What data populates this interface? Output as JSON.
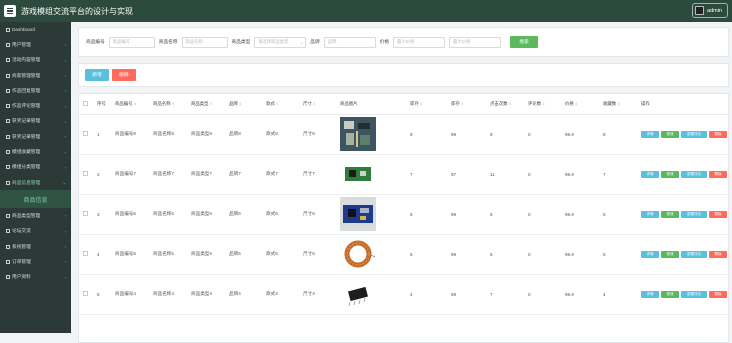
{
  "app": {
    "title": "游戏模组交流平台的设计与实现",
    "user": "admin"
  },
  "sidebar": {
    "items": [
      {
        "label": "Dashboard",
        "icon": "home-icon"
      },
      {
        "label": "用户管理",
        "icon": "user-icon"
      },
      {
        "label": "活动内容管理",
        "icon": "list-icon"
      },
      {
        "label": "商家管理管理",
        "icon": "store-icon"
      },
      {
        "label": "作品回复管理",
        "icon": "grid-icon"
      },
      {
        "label": "作品评论管理",
        "icon": "comment-icon"
      },
      {
        "label": "获奖记录管理",
        "icon": "grid-icon"
      },
      {
        "label": "获奖记录管理",
        "icon": "grid-icon"
      },
      {
        "label": "模组收藏管理",
        "icon": "grid-icon"
      },
      {
        "label": "模组分类管理",
        "icon": "grid-icon"
      },
      {
        "label": "商品信息管理",
        "icon": "grid-icon"
      }
    ],
    "active_sub": "商品信息",
    "items_after": [
      {
        "label": "商品类型管理",
        "icon": "grid-icon"
      },
      {
        "label": "论坛交流",
        "icon": "grid-icon"
      },
      {
        "label": "系统管理",
        "icon": "grid-icon"
      },
      {
        "label": "订单管理",
        "icon": "grid-icon"
      },
      {
        "label": "用户资料",
        "icon": "user-icon"
      }
    ]
  },
  "filters": {
    "code_label": "商品编号",
    "code_placeholder": "商品编号",
    "name_label": "商品名称",
    "name_placeholder": "商品名称",
    "type_label": "商品类型",
    "type_placeholder": "请选择商品类型",
    "brand_label": "品牌",
    "brand_placeholder": "品牌",
    "price_label": "价格",
    "price_min_placeholder": "最小价格",
    "price_max_placeholder": "最大价格",
    "search_button": "搜索"
  },
  "actions": {
    "add": "新增",
    "delete": "删除"
  },
  "table": {
    "headers": [
      "序号",
      "商品编号",
      "商品名称",
      "商品类型",
      "品牌",
      "款式",
      "尺寸",
      "商品图片",
      "库存",
      "库存",
      "点击次数",
      "评论数",
      "价格",
      "收藏数",
      "操作"
    ],
    "rows": [
      {
        "index": "1",
        "code": "商品编号8",
        "name": "商品名称8",
        "type": "商品类型8",
        "brand": "品牌8",
        "style": "款式8",
        "size": "尺寸8",
        "image": "circuit-board",
        "stock": "8",
        "stock2": "99",
        "clicks": "8",
        "comments": "0",
        "price": "99.9",
        "favorites": "8"
      },
      {
        "index": "2",
        "code": "商品编号7",
        "name": "商品名称7",
        "type": "商品类型7",
        "brand": "品牌7",
        "style": "款式7",
        "size": "尺寸7",
        "image": "green-module",
        "stock": "7",
        "stock2": "97",
        "clicks": "11",
        "comments": "0",
        "price": "99.9",
        "favorites": "7"
      },
      {
        "index": "3",
        "code": "商品编号6",
        "name": "商品名称6",
        "type": "商品类型6",
        "brand": "品牌6",
        "style": "款式6",
        "size": "尺寸6",
        "image": "blue-board",
        "stock": "6",
        "stock2": "99",
        "clicks": "6",
        "comments": "0",
        "price": "99.9",
        "favorites": "6"
      },
      {
        "index": "4",
        "code": "商品编号5",
        "name": "商品名称5",
        "type": "商品类型5",
        "brand": "品牌5",
        "style": "款式5",
        "size": "尺寸5",
        "image": "ferrite-coil",
        "stock": "5",
        "stock2": "99",
        "clicks": "5",
        "comments": "0",
        "price": "99.9",
        "favorites": "5"
      },
      {
        "index": "5",
        "code": "商品编号4",
        "name": "商品名称4",
        "type": "商品类型4",
        "brand": "品牌4",
        "style": "款式4",
        "size": "尺寸4",
        "image": "ic-chip",
        "stock": "4",
        "stock2": "98",
        "clicks": "7",
        "comments": "0",
        "price": "99.9",
        "favorites": "4"
      }
    ],
    "row_actions": {
      "detail": "详情",
      "edit": "修改",
      "review": "查看评论",
      "delete": "删除"
    }
  }
}
